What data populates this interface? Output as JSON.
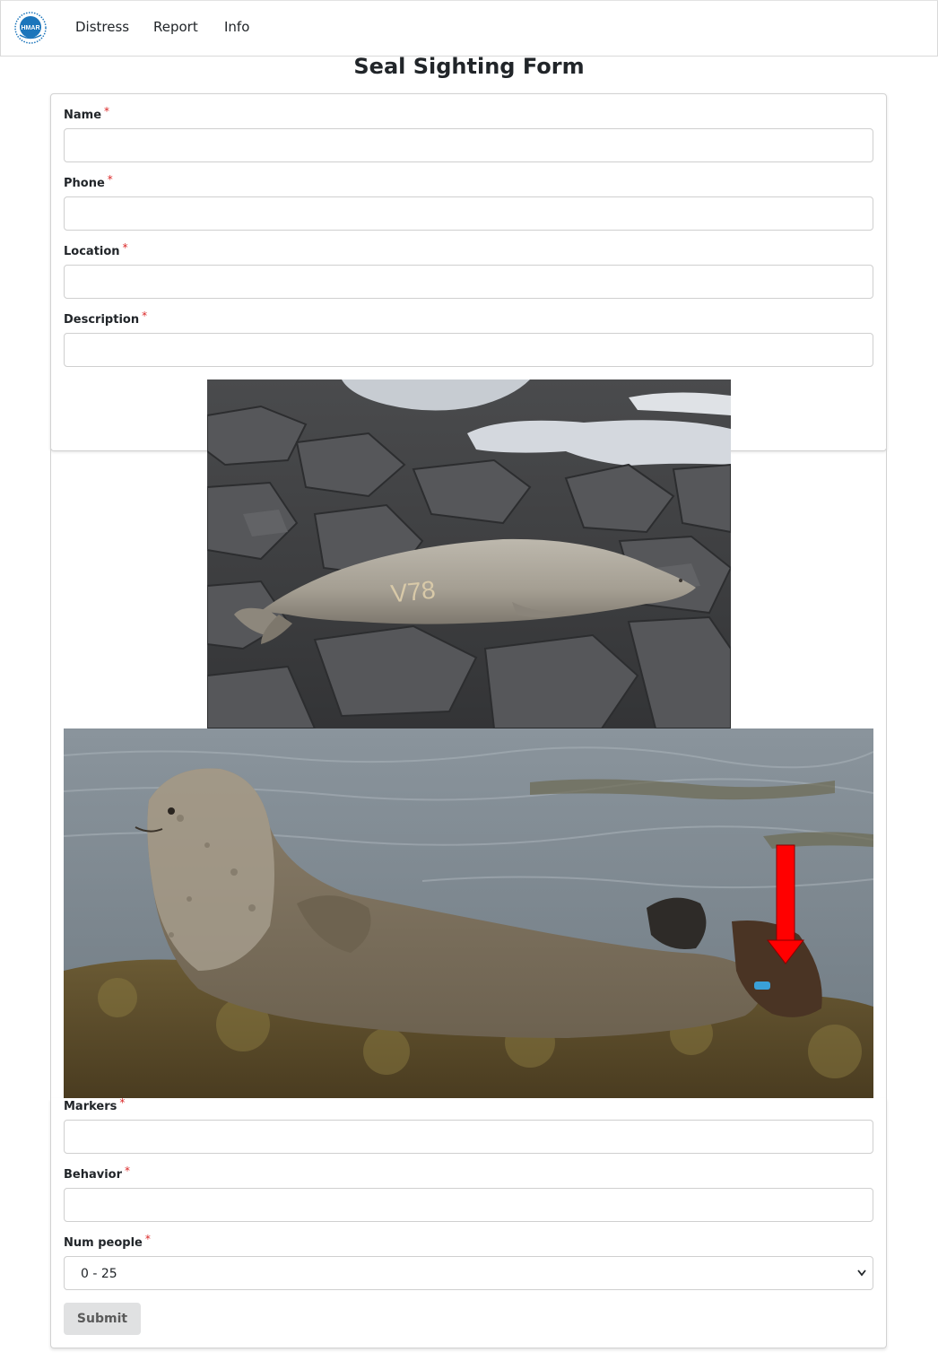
{
  "nav": {
    "logo_text": "HMAR",
    "items": [
      {
        "label": "Distress"
      },
      {
        "label": "Report"
      },
      {
        "label": "Info"
      }
    ]
  },
  "form": {
    "title": "Seal Sighting Form",
    "required_marker": "*",
    "fields": {
      "name": {
        "label": "Name",
        "value": ""
      },
      "phone": {
        "label": "Phone",
        "value": ""
      },
      "location": {
        "label": "Location",
        "value": ""
      },
      "description": {
        "label": "Description",
        "value": ""
      },
      "markers": {
        "label": "Markers",
        "value": ""
      },
      "behavior": {
        "label": "Behavior",
        "value": ""
      },
      "num_people": {
        "label": "Num people",
        "selected": "0 - 25"
      }
    },
    "photos": [
      {
        "name": "seal-on-rocks-photo",
        "bleach_mark": "V78"
      },
      {
        "name": "harbor-seal-flipper-tag-photo",
        "arrow_color": "#ff0000",
        "tag_color": "#3aa0d8"
      }
    ],
    "submit_label": "Submit"
  },
  "colors": {
    "required": "#db2828",
    "button_bg": "#e0e1e2",
    "logo_blue": "#1b75bb"
  }
}
